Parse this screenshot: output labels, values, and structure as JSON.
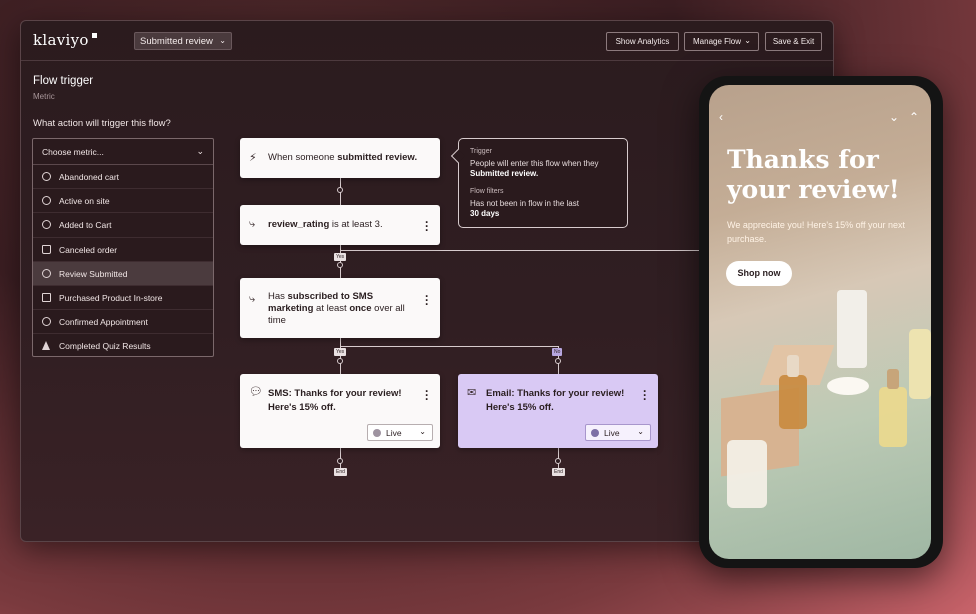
{
  "app": {
    "logo": "klaviyo",
    "flow_name": "Submitted review"
  },
  "toolbar": {
    "show_analytics": "Show Analytics",
    "manage_flow": "Manage Flow",
    "save_exit": "Save & Exit"
  },
  "trigger": {
    "title": "Flow trigger",
    "subtitle": "Metric",
    "question": "What action will trigger this flow?",
    "placeholder": "Choose metric...",
    "metrics": [
      {
        "label": "Abandoned cart",
        "icon": "gear-icon"
      },
      {
        "label": "Active on site",
        "icon": "gear-icon"
      },
      {
        "label": "Added to Cart",
        "icon": "gear-icon"
      },
      {
        "label": "Canceled order",
        "icon": "shopify-bag-icon"
      },
      {
        "label": "Review Submitted",
        "icon": "gear-icon",
        "selected": true
      },
      {
        "label": "Purchased Product In-store",
        "icon": "square-icon"
      },
      {
        "label": "Confirmed Appointment",
        "icon": "gear-icon"
      },
      {
        "label": "Completed Quiz Results",
        "icon": "flame-icon"
      }
    ]
  },
  "flow": {
    "trigger_node": {
      "prefix": "When someone ",
      "bold": "submitted review."
    },
    "split1": {
      "bold": "review_rating",
      "rest": " is at least 3."
    },
    "split2": {
      "prefix": "Has ",
      "bold1": "subscribed to SMS marketing",
      "mid": " at least ",
      "bold2": "once",
      "suffix": " over all time"
    },
    "sms": {
      "title": "SMS: Thanks for your review! Here's 15% off.",
      "status": "Live"
    },
    "email": {
      "title": "Email: Thanks for your review! Here's 15% off.",
      "status": "Live"
    },
    "tags": {
      "yes": "Yes",
      "no": "No",
      "end": "End"
    },
    "tooltip": {
      "trigger_label": "Trigger",
      "trigger_text": "People will enter this flow when they",
      "trigger_bold": "Submitted review.",
      "filters_label": "Flow filters",
      "filters_text": "Has not been in flow in the last",
      "filters_bold": "30 days"
    }
  },
  "phone": {
    "headline_line1": "Thanks for",
    "headline_line2": "your review!",
    "subtext": "We appreciate you! Here's 15% off your next purchase.",
    "button": "Shop now"
  },
  "colors": {
    "accent_purple": "#d9c9f4",
    "node_bg": "#fbf9f9",
    "window_bg": "#2b1b1e"
  }
}
